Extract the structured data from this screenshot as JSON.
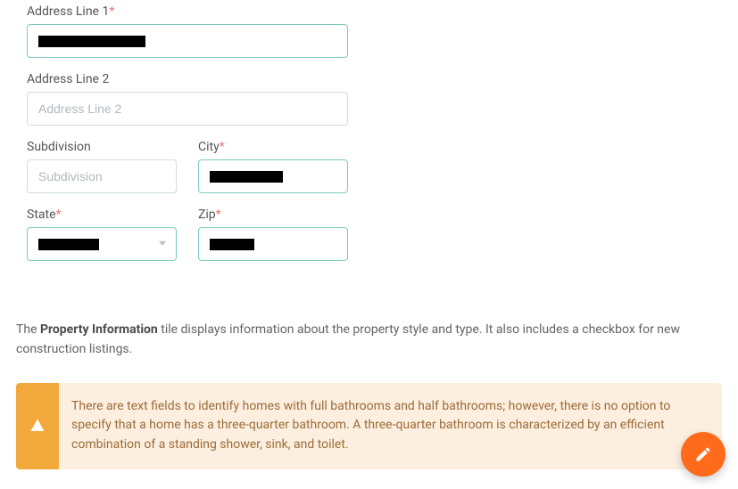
{
  "form": {
    "address1": {
      "label": "Address Line 1",
      "required": true,
      "value": "████████████",
      "placeholder": ""
    },
    "address2": {
      "label": "Address Line 2",
      "required": false,
      "value": "",
      "placeholder": "Address Line 2"
    },
    "subdivision": {
      "label": "Subdivision",
      "required": false,
      "value": "",
      "placeholder": "Subdivision"
    },
    "city": {
      "label": "City",
      "required": true,
      "value": "████████",
      "placeholder": ""
    },
    "state": {
      "label": "State",
      "required": true,
      "value": "██████",
      "placeholder": ""
    },
    "zip": {
      "label": "Zip",
      "required": true,
      "value": "█████",
      "placeholder": ""
    }
  },
  "paragraph": {
    "prefix": "The ",
    "strong": "Property Information",
    "suffix": " tile displays information about the property style and type. It also includes a checkbox for new construction listings."
  },
  "alert": {
    "text": "There are text fields to identify homes with full bathrooms and half bathrooms; however, there is no option to specify that a home has a three-quarter bathroom. A three-quarter bathroom is characterized by an efficient combination of a standing shower, sink, and toilet."
  },
  "colors": {
    "accent_teal": "#7fc9c0",
    "warn_bg": "#fdefe0",
    "warn_icon": "#f3a83c",
    "fab": "#ff6b1a",
    "required": "#e97878"
  }
}
